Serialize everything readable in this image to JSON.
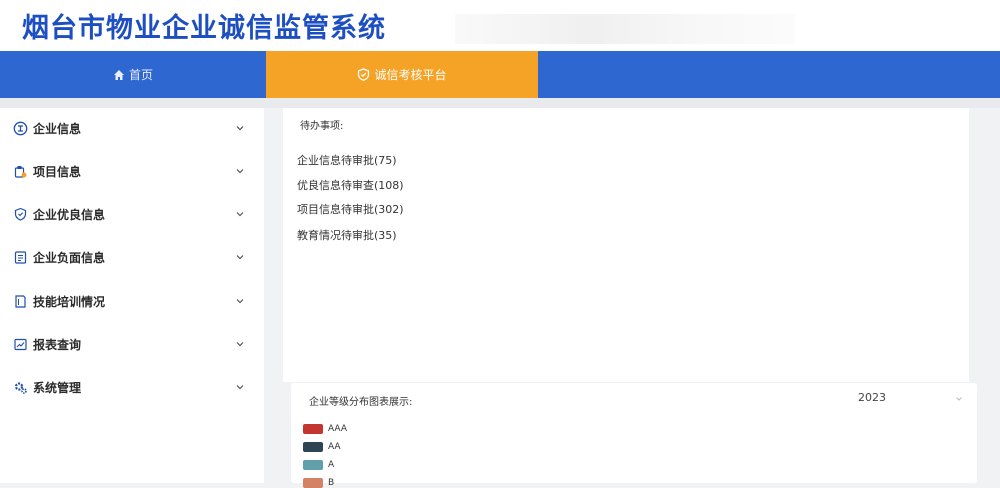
{
  "header": {
    "title": "烟台市物业企业诚信监管系统"
  },
  "nav": {
    "tabs": [
      {
        "label": "首页",
        "icon": "home-icon"
      },
      {
        "label": "诚信考核平台",
        "icon": "shield-icon"
      }
    ],
    "active_color": "#f4a326",
    "bg_color": "#2e67cf"
  },
  "sidebar": {
    "items": [
      {
        "label": "企业信息",
        "icon": "enterprise-icon"
      },
      {
        "label": "项目信息",
        "icon": "project-icon"
      },
      {
        "label": "企业优良信息",
        "icon": "good-record-icon"
      },
      {
        "label": "企业负面信息",
        "icon": "negative-record-icon"
      },
      {
        "label": "技能培训情况",
        "icon": "training-icon"
      },
      {
        "label": "报表查询",
        "icon": "report-icon"
      },
      {
        "label": "系统管理",
        "icon": "settings-icon"
      }
    ]
  },
  "todo": {
    "title": "待办事项:",
    "items": [
      "企业信息待审批(75)",
      "优良信息待审查(108)",
      "项目信息待审批(302)",
      "教育情况待审批(35)"
    ]
  },
  "chart_panel": {
    "title": "企业等级分布图表展示:",
    "year": "2023",
    "legend": [
      {
        "label": "AAA",
        "color": "#c23531"
      },
      {
        "label": "AA",
        "color": "#2f4554"
      },
      {
        "label": "A",
        "color": "#61a0a8"
      },
      {
        "label": "B",
        "color": "#d48265"
      }
    ]
  }
}
